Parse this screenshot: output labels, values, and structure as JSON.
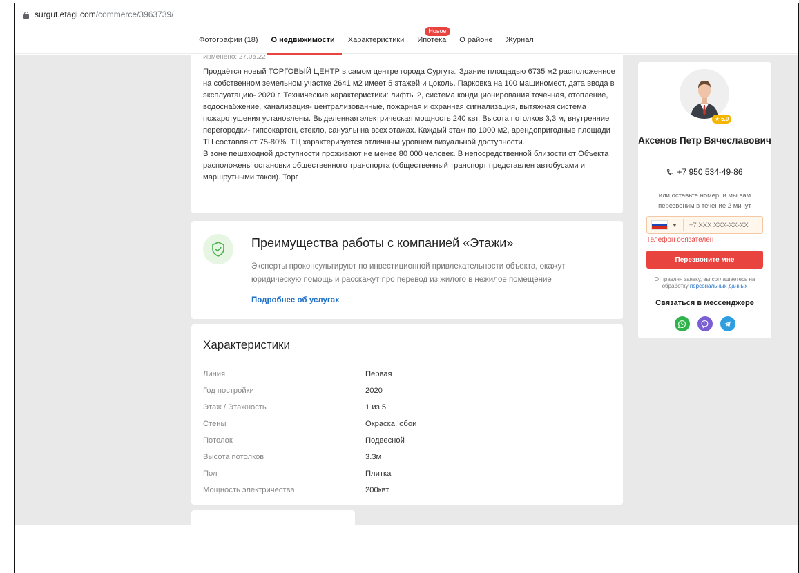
{
  "browser": {
    "url_host": "surgut.etagi.com",
    "url_path": "/commerce/3963739/"
  },
  "nav": {
    "tabs": [
      {
        "label": "Фотографии (18)"
      },
      {
        "label": "О недвижимости"
      },
      {
        "label": "Характеристики"
      },
      {
        "label": "Ипотека",
        "badge": "Новое"
      },
      {
        "label": "О районе"
      },
      {
        "label": "Журнал"
      }
    ]
  },
  "description": {
    "changed": "Изменено: 27.05.22",
    "paragraphs": [
      "Продаётся новый ТОРГОВЫЙ ЦЕНТР в самом центре города Сургута. Здание площадью 6735 м2 расположенное на собственном земельном участке 2641 м2 имеет 5 этажей и цоколь. Парковка на 100 машиномест, дата ввода в эксплуатацию- 2020 г. Технические характеристики: лифты 2, система кондиционирования точечная, отопление, водоснабжение, канализация- централизованные, пожарная и охранная сигнализация, вытяжная система пожаротушения установлены. Выделенная электрическая мощность 240 квт. Высота потолков 3,3 м, внутренние перегородки- гипсокартон, стекло, санузлы на всех этажах. Каждый этаж по 1000 м2, арендопригодные площади ТЦ составляют 75-80%. ТЦ характеризуется отличным уровнем визуальной доступности.",
      "В зоне пешеходной доступности проживают не менее 80 000 человек. В непосредственной близости от Объекта расположены остановки общественного транспорта (общественный транспорт представлен автобусами и маршрутными такси). Торг"
    ]
  },
  "advantages": {
    "title": "Преимущества работы с компанией «Этажи»",
    "subtitle": "Эксперты проконсультируют по инвестиционной привлекательности объекта, окажут юридическую помощь и расскажут про перевод из жилого в нежилое помещение",
    "link": "Подробнее об услугах",
    "accent_color": "#4caf50"
  },
  "characteristics": {
    "title": "Характеристики",
    "rows": [
      {
        "key": "Линия",
        "value": "Первая"
      },
      {
        "key": "Год постройки",
        "value": "2020"
      },
      {
        "key": "Этаж / Этажность",
        "value": "1 из 5"
      },
      {
        "key": "Стены",
        "value": "Окраска, обои"
      },
      {
        "key": "Потолок",
        "value": "Подвесной"
      },
      {
        "key": "Высота потолков",
        "value": "3.3м"
      },
      {
        "key": "Пол",
        "value": "Плитка"
      },
      {
        "key": "Мощность электричества",
        "value": "200квт"
      }
    ]
  },
  "agent": {
    "rating": "5.0",
    "name": "Аксенов Петр Вячеславович",
    "phone": "+7 950 534-49-86",
    "hint": "или оставьте номер, и мы вам перезвоним в течение 2 минут",
    "phone_placeholder": "+7 XXX XXX-XX-XX",
    "error": "Телефон обязателен",
    "cta": "Перезвоните мне",
    "consent_text": "Отправляя заявку, вы соглашаетесь на обработку",
    "consent_link": "персональных данных",
    "messenger_title": "Связаться в мессенджере",
    "messengers": [
      {
        "icon": "whatsapp-icon",
        "color": "#2fb34a"
      },
      {
        "icon": "viber-icon",
        "color": "#7a5fd4"
      },
      {
        "icon": "telegram-icon",
        "color": "#2f9ee0"
      }
    ],
    "brand_color": "#e8433e"
  }
}
